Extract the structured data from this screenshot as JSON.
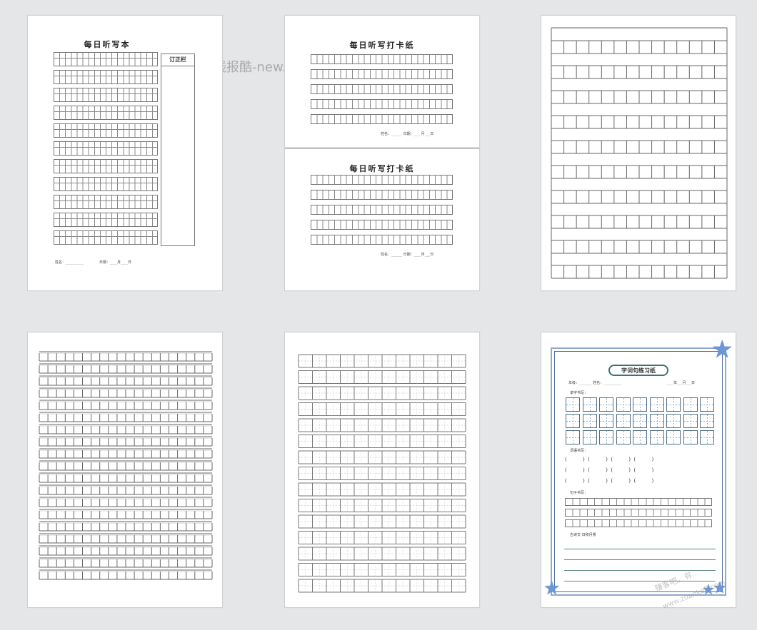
{
  "watermark_top": "线报酷-new.xianbao.fun",
  "watermark_corner_line1": "赚客吧，有...",
  "watermark_corner_line2": "www.zuanke8.com",
  "sheet1": {
    "title": "每日听写本",
    "correction_label": "订正栏",
    "footer_name": "姓名：__________",
    "footer_date": "日期：____月____日"
  },
  "sheet2": {
    "title_top": "每日听写打卡纸",
    "title_bottom": "每日听写打卡纸",
    "footer_top": "姓名：______ 日期：____月___日",
    "footer_bottom": "姓名：______ 日期：____月___日"
  },
  "sheet6": {
    "title": "字词句练习纸",
    "header_fields": "年级：_______ 姓名：__________",
    "header_date": "____年___月___日",
    "section_single": "单字书写：",
    "section_words": "词语书写：",
    "section_sentence": "句子书写：",
    "section_poem": "古诗文·日积月累",
    "paren_row": "(          )  (          )  (          )  (          )"
  }
}
